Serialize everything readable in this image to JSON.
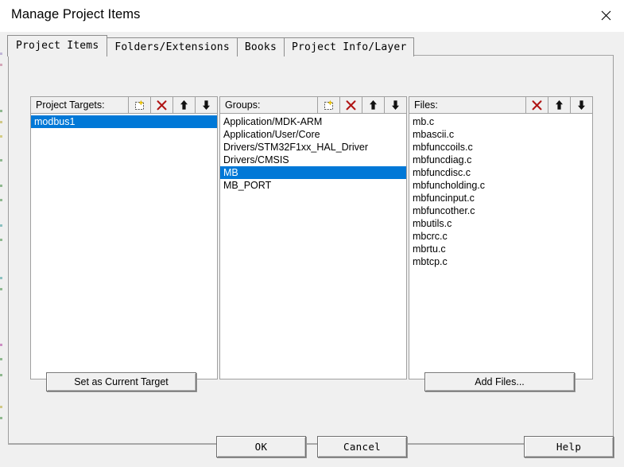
{
  "window": {
    "title": "Manage Project Items",
    "close_icon": "close-icon"
  },
  "tabs": [
    {
      "label": "Project Items",
      "selected": true
    },
    {
      "label": "Folders/Extensions",
      "selected": false
    },
    {
      "label": "Books",
      "selected": false
    },
    {
      "label": "Project Info/Layer",
      "selected": false
    }
  ],
  "colors": {
    "selection_blue": "#0078d7",
    "delete_red": "#b01515",
    "dialog_face": "#f0f0f0",
    "list_background": "#ffffff",
    "border": "#a0a0a0"
  },
  "panels": {
    "targets": {
      "label": "Project Targets:",
      "tools": [
        "new-item-icon",
        "delete-icon",
        "move-up-icon",
        "move-down-icon"
      ],
      "items": [
        {
          "label": "modbus1",
          "selected": true
        }
      ]
    },
    "groups": {
      "label": "Groups:",
      "tools": [
        "new-item-icon",
        "delete-icon",
        "move-up-icon",
        "move-down-icon"
      ],
      "items": [
        {
          "label": "Application/MDK-ARM",
          "selected": false
        },
        {
          "label": "Application/User/Core",
          "selected": false
        },
        {
          "label": "Drivers/STM32F1xx_HAL_Driver",
          "selected": false
        },
        {
          "label": "Drivers/CMSIS",
          "selected": false
        },
        {
          "label": "MB",
          "selected": true
        },
        {
          "label": "MB_PORT",
          "selected": false
        }
      ]
    },
    "files": {
      "label": "Files:",
      "tools": [
        "delete-icon",
        "move-up-icon",
        "move-down-icon"
      ],
      "items": [
        {
          "label": "mb.c",
          "selected": false
        },
        {
          "label": "mbascii.c",
          "selected": false
        },
        {
          "label": "mbfunccoils.c",
          "selected": false
        },
        {
          "label": "mbfuncdiag.c",
          "selected": false
        },
        {
          "label": "mbfuncdisc.c",
          "selected": false
        },
        {
          "label": "mbfuncholding.c",
          "selected": false
        },
        {
          "label": "mbfuncinput.c",
          "selected": false
        },
        {
          "label": "mbfuncother.c",
          "selected": false
        },
        {
          "label": "mbutils.c",
          "selected": false
        },
        {
          "label": "mbcrc.c",
          "selected": false
        },
        {
          "label": "mbrtu.c",
          "selected": false
        },
        {
          "label": "mbtcp.c",
          "selected": false
        }
      ]
    }
  },
  "actions": {
    "set_current_target": "Set as Current Target",
    "add_files": "Add Files...",
    "ok": "OK",
    "cancel": "Cancel",
    "help": "Help"
  }
}
